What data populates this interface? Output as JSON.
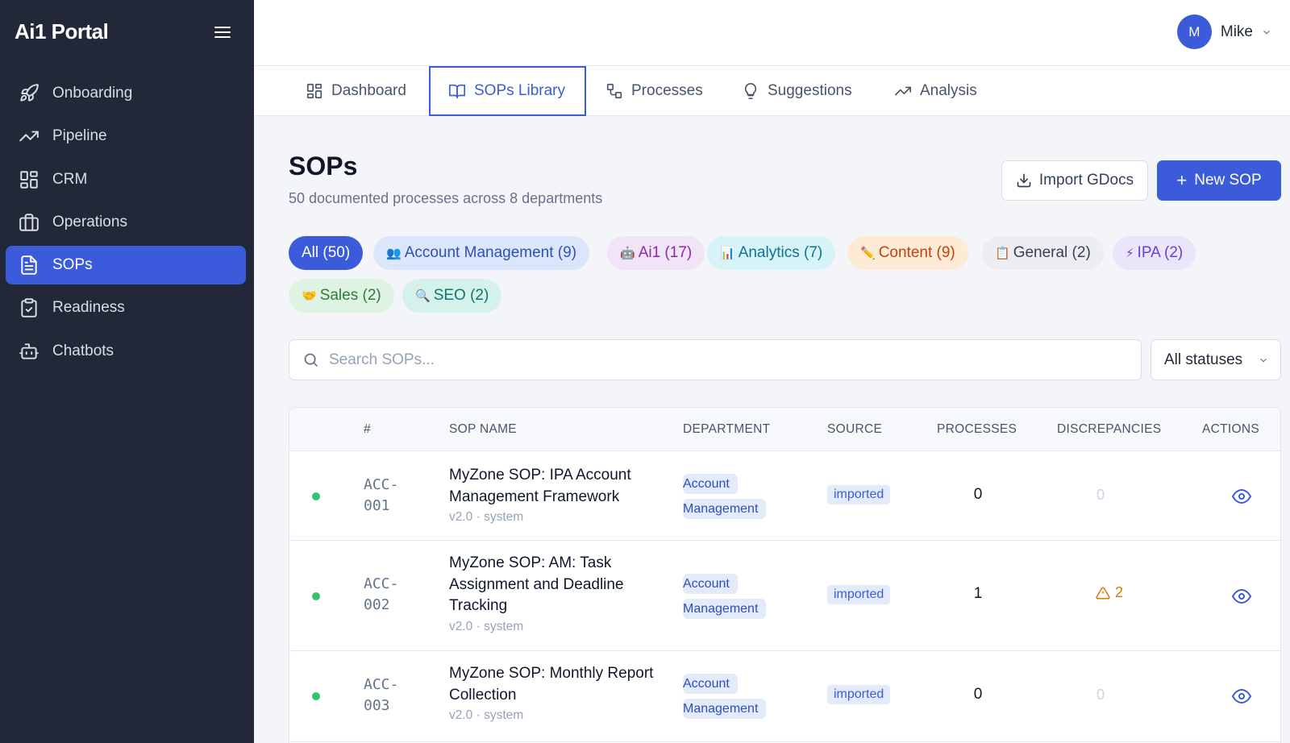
{
  "brand": "Ai1 Portal",
  "sidebar": {
    "items": [
      {
        "label": "Onboarding",
        "icon": "rocket-icon"
      },
      {
        "label": "Pipeline",
        "icon": "trending-up-icon"
      },
      {
        "label": "CRM",
        "icon": "grid-icon"
      },
      {
        "label": "Operations",
        "icon": "briefcase-icon"
      },
      {
        "label": "SOPs",
        "icon": "document-icon",
        "active": true
      },
      {
        "label": "Readiness",
        "icon": "clipboard-check-icon"
      },
      {
        "label": "Chatbots",
        "icon": "bot-icon"
      }
    ]
  },
  "user": {
    "initial": "M",
    "name": "Mike"
  },
  "tabs": [
    {
      "label": "Dashboard",
      "icon": "dashboard-icon"
    },
    {
      "label": "SOPs Library",
      "icon": "book-icon",
      "active": true
    },
    {
      "label": "Processes",
      "icon": "flow-icon"
    },
    {
      "label": "Suggestions",
      "icon": "lightbulb-icon"
    },
    {
      "label": "Analysis",
      "icon": "trending-up-icon"
    }
  ],
  "page": {
    "title": "SOPs",
    "subtitle": "50 documented processes across 8 departments",
    "import_label": "Import GDocs",
    "new_label": "New SOP"
  },
  "filters": [
    {
      "emoji": "",
      "label": "All (50)",
      "bg": "#3b5bdb",
      "fg": "#ffffff"
    },
    {
      "emoji": "👥",
      "label": "Account Management (9)",
      "bg": "#dbe6fb",
      "fg": "#2f4fb8"
    },
    {
      "emoji": "🤖",
      "label": "Ai1 (17)",
      "bg": "#f1e4f6",
      "fg": "#8a2aa6"
    },
    {
      "emoji": "📊",
      "label": "Analytics (7)",
      "bg": "#d6f3f7",
      "fg": "#0e7490"
    },
    {
      "emoji": "✏️",
      "label": "Content (9)",
      "bg": "#fdebd6",
      "fg": "#c2410c"
    },
    {
      "emoji": "📋",
      "label": "General (2)",
      "bg": "#eceef2",
      "fg": "#374151"
    },
    {
      "emoji": "⚡",
      "label": "IPA (2)",
      "bg": "#ebe5fa",
      "fg": "#6d3fd1"
    },
    {
      "emoji": "🤝",
      "label": "Sales (2)",
      "bg": "#dff3e3",
      "fg": "#2f7a3d"
    },
    {
      "emoji": "🔍",
      "label": "SEO (2)",
      "bg": "#d4f1ea",
      "fg": "#0f766e"
    }
  ],
  "search": {
    "placeholder": "Search SOPs..."
  },
  "status_filter": {
    "value": "All statuses"
  },
  "table": {
    "columns": [
      "#",
      "SOP NAME",
      "DEPARTMENT",
      "SOURCE",
      "PROCESSES",
      "DISCREPANCIES",
      "ACTIONS"
    ],
    "rows": [
      {
        "code": "ACC-001",
        "name": "MyZone SOP: IPA Account Management Framework",
        "meta": "v2.0 · system",
        "dept_1": "Account",
        "dept_2": "Management",
        "source": "imported",
        "processes": "0",
        "discrepancies": "0",
        "status_color": "#34c46a"
      },
      {
        "code": "ACC-002",
        "name": "MyZone SOP: AM: Task Assignment and Deadline Tracking",
        "meta": "v2.0 · system",
        "dept_1": "Account",
        "dept_2": "Management",
        "source": "imported",
        "processes": "1",
        "discrepancies": "2",
        "status_color": "#34c46a"
      },
      {
        "code": "ACC-003",
        "name": "MyZone SOP: Monthly Report Collection",
        "meta": "v2.0 · system",
        "dept_1": "Account",
        "dept_2": "Management",
        "source": "imported",
        "processes": "0",
        "discrepancies": "0",
        "status_color": "#34c46a"
      }
    ]
  },
  "colors": {
    "accent": "#3b5bdb",
    "sidebar_bg": "#222838",
    "success": "#34c46a",
    "warning": "#d97706"
  }
}
